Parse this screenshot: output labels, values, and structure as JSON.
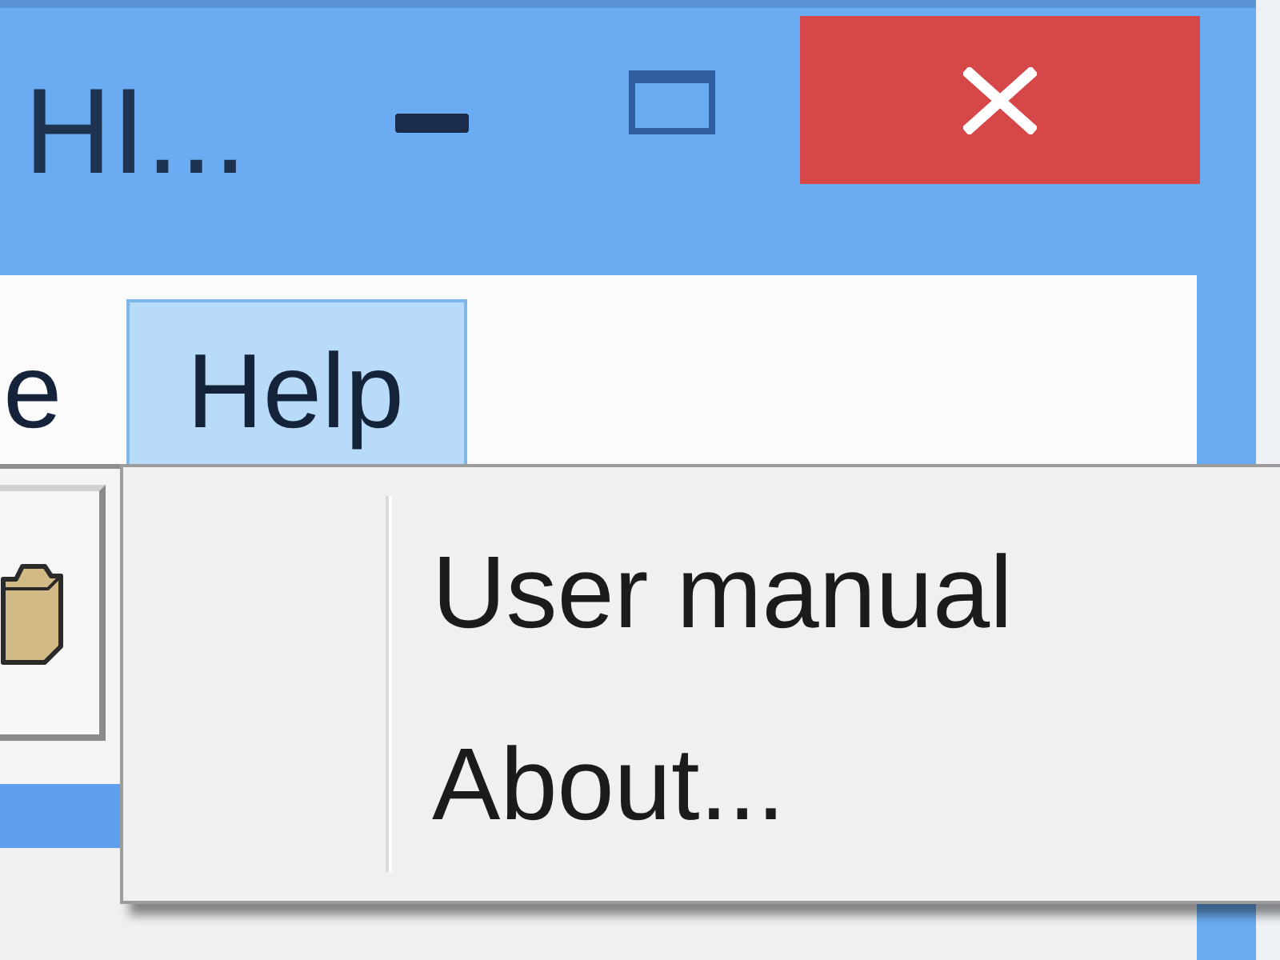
{
  "window": {
    "title": "HI..."
  },
  "menu_bar": [
    {
      "label": "e",
      "selected": false
    },
    {
      "label": "Help",
      "selected": true
    }
  ],
  "help_menu": {
    "items": [
      {
        "label": "User manual",
        "selected": false
      },
      {
        "label": "About...",
        "selected": false
      }
    ]
  }
}
